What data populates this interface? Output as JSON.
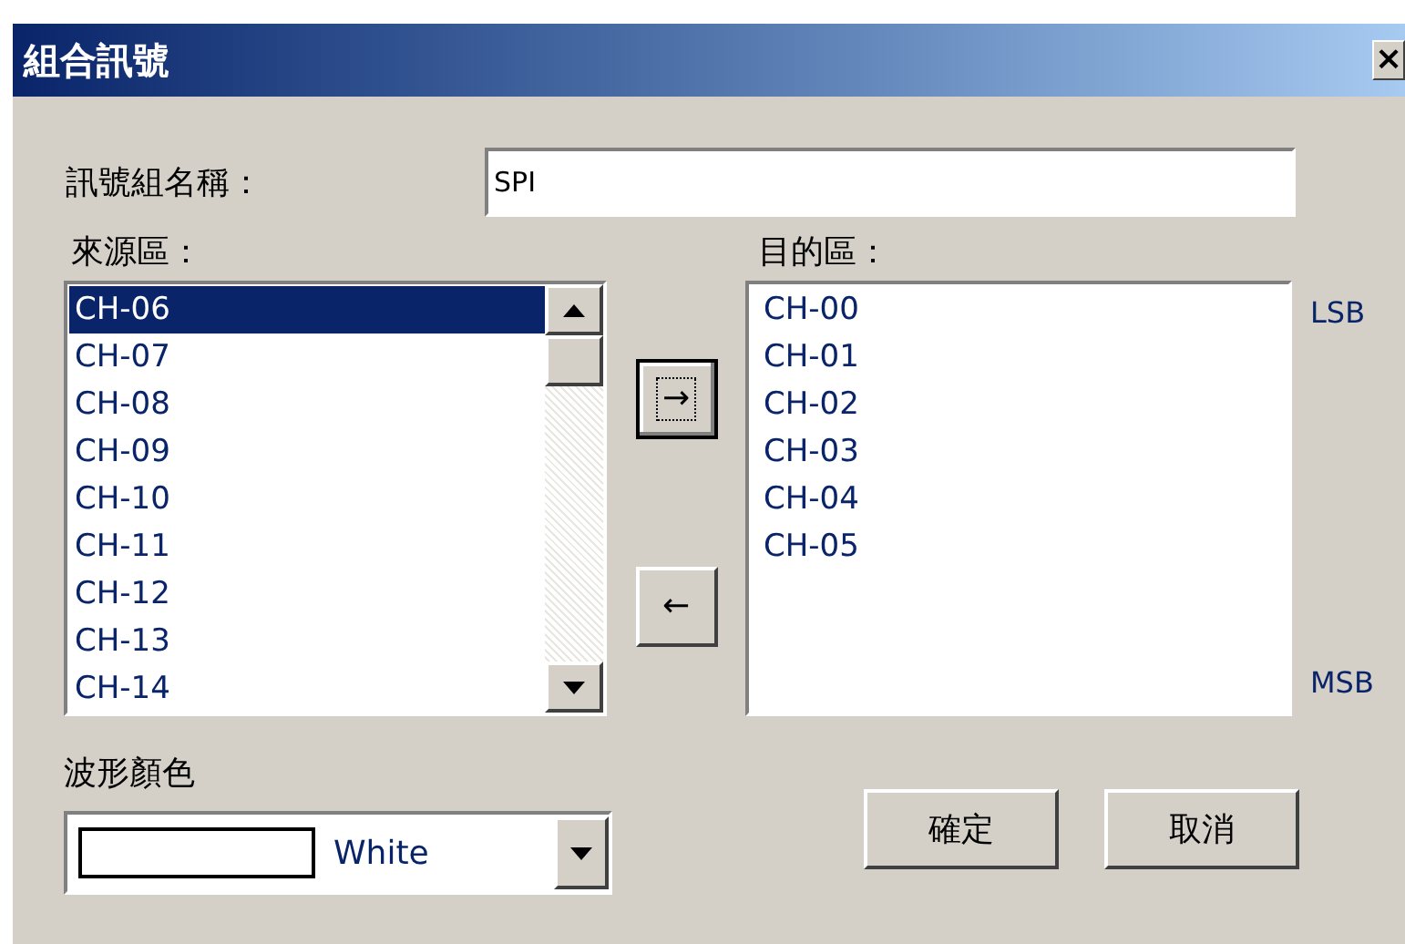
{
  "window": {
    "title": "組合訊號",
    "close": "×"
  },
  "name_field": {
    "label": "訊號組名稱：",
    "value": "SPI"
  },
  "source": {
    "label": "來源區：",
    "items": [
      {
        "text": "CH-06",
        "selected": true
      },
      {
        "text": "CH-07",
        "selected": false
      },
      {
        "text": "CH-08",
        "selected": false
      },
      {
        "text": "CH-09",
        "selected": false
      },
      {
        "text": "CH-10",
        "selected": false
      },
      {
        "text": "CH-11",
        "selected": false
      },
      {
        "text": "CH-12",
        "selected": false
      },
      {
        "text": "CH-13",
        "selected": false
      },
      {
        "text": "CH-14",
        "selected": false
      }
    ]
  },
  "move_buttons": [
    {
      "symbol": "→",
      "focused": true
    },
    {
      "symbol": "←",
      "focused": false
    }
  ],
  "target": {
    "label": "目的區：",
    "items": [
      {
        "text": "CH-00",
        "selected": false
      },
      {
        "text": "CH-01",
        "selected": false
      },
      {
        "text": "CH-02",
        "selected": false
      },
      {
        "text": "CH-03",
        "selected": false
      },
      {
        "text": "CH-04",
        "selected": false
      },
      {
        "text": "CH-05",
        "selected": false
      }
    ],
    "top_label": "LSB",
    "bottom_label": "MSB"
  },
  "waveform_color": {
    "label": "波形顏色",
    "value": "White",
    "color": "#ffffff"
  },
  "buttons": [
    "確定",
    "取消"
  ]
}
